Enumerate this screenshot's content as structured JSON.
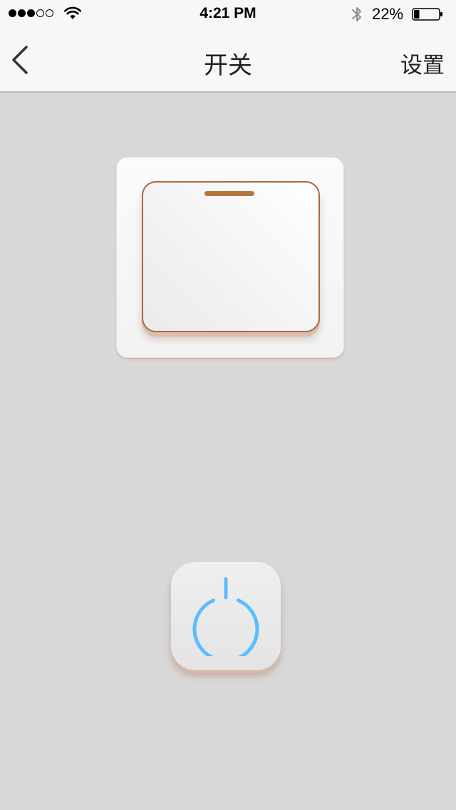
{
  "status_bar": {
    "signal_dots": [
      true,
      true,
      true,
      false,
      false
    ],
    "time": "4:21 PM",
    "battery_percent": "22%",
    "battery_level": 0.22
  },
  "nav_bar": {
    "title": "开关",
    "right_button_label": "设置",
    "back_icon": "chevron-left-icon"
  },
  "switch": {
    "state": "off"
  },
  "power_button": {
    "icon": "power-icon",
    "icon_color": "#5bbcff"
  },
  "colors": {
    "background": "#d8d8d8",
    "bar": "#f7f7f8",
    "accent_copper": "#a86a44",
    "power_blue": "#5bbcff"
  }
}
